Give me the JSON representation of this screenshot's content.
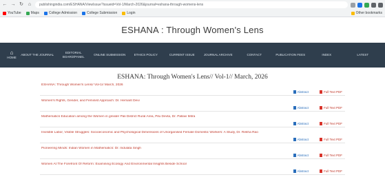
{
  "browser": {
    "url": "publishingindia.com/ESHANA/ViewIssue?issueid=Vol-1/March-2026&journal=eshana-through-womens-lens",
    "bookmarks": [
      "YouTube",
      "Maps",
      "College Admission",
      "College Submission",
      "Login"
    ],
    "bookmarks_right": "Other bookmarks"
  },
  "site": {
    "title": "ESHANA : Through Women's Lens"
  },
  "menu": {
    "home_label": "HOME",
    "items": [
      "ABOUT THE JOURNAL",
      "EDITORIAL BOARD/PANEL",
      "ONLINE SUBMISSION",
      "ETHICS POLICY",
      "CURRENT ISSUE",
      "JOURNAL ARCHIVE",
      "CONTACT",
      "PUBLICATION FEES",
      "INDEX",
      "LATEST"
    ]
  },
  "issue": {
    "heading": "ESHANA: Through Women's Lens// Vol-1// March, 2026",
    "abstract_label": "Abstract",
    "pdf_label": "Full Text PDF",
    "articles": [
      "ESHANA: Through Women's Lens// Vol-1// March, 2026",
      "Women's Rights, Gender, and Feminist Approach: Dr. Hemant Devi",
      "Mathematics Education among the Women in greater Pali District Rural Area, Pilu Devta, Dr. Pallavi Mitra",
      "Invisible Labor, Visible Struggles: Socioeconomic and Psychological Dimensions of Unorganised Female Domestic Workers: A Study, Dr. Rekha Rao",
      "Pioneering Minds: Indian Women in Mathematics: Dr. Indulata Singh",
      "Women At The Forefront Of Reform: Examining Ecology And Environmental Insights Beside School"
    ]
  },
  "colors": {
    "menu_bg": "#2f3e4d",
    "article_title": "#c0392b",
    "abstract_link": "#2a6ebb",
    "pdf_link": "#c0392b"
  }
}
